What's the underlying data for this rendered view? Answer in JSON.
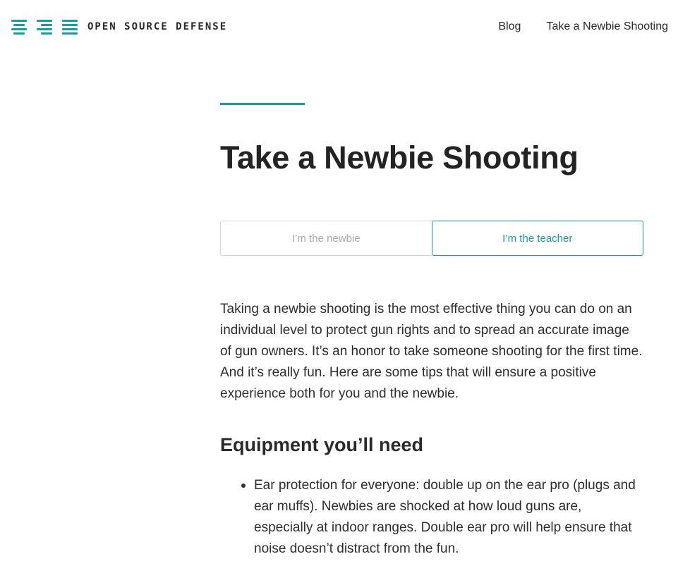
{
  "header": {
    "logo_text": "OPEN SOURCE DEFENSE",
    "nav": [
      {
        "label": "Blog"
      },
      {
        "label": "Take a Newbie Shooting"
      }
    ]
  },
  "colors": {
    "accent": "#1a9e9a",
    "text": "#2e2e2e",
    "muted": "#a9a9a9",
    "border": "#d6d6d6"
  },
  "page": {
    "title": "Take a Newbie Shooting",
    "tabs": [
      {
        "label": "I’m the newbie",
        "active": false
      },
      {
        "label": "I’m the teacher",
        "active": true
      }
    ],
    "intro": "Taking a newbie shooting is the most effective thing you can do on an individual level to protect gun rights and to spread an accurate image of gun owners. It’s an honor to take someone shooting for the first time. And it’s really fun. Here are some tips that will ensure a positive experience both for you and the newbie.",
    "section_heading": "Equipment you’ll need",
    "items": [
      "Ear protection for everyone: double up on the ear pro (plugs and ear muffs). Newbies are shocked at how loud guns are, especially at indoor ranges. Double ear pro will help ensure that noise doesn’t distract from the fun."
    ]
  }
}
